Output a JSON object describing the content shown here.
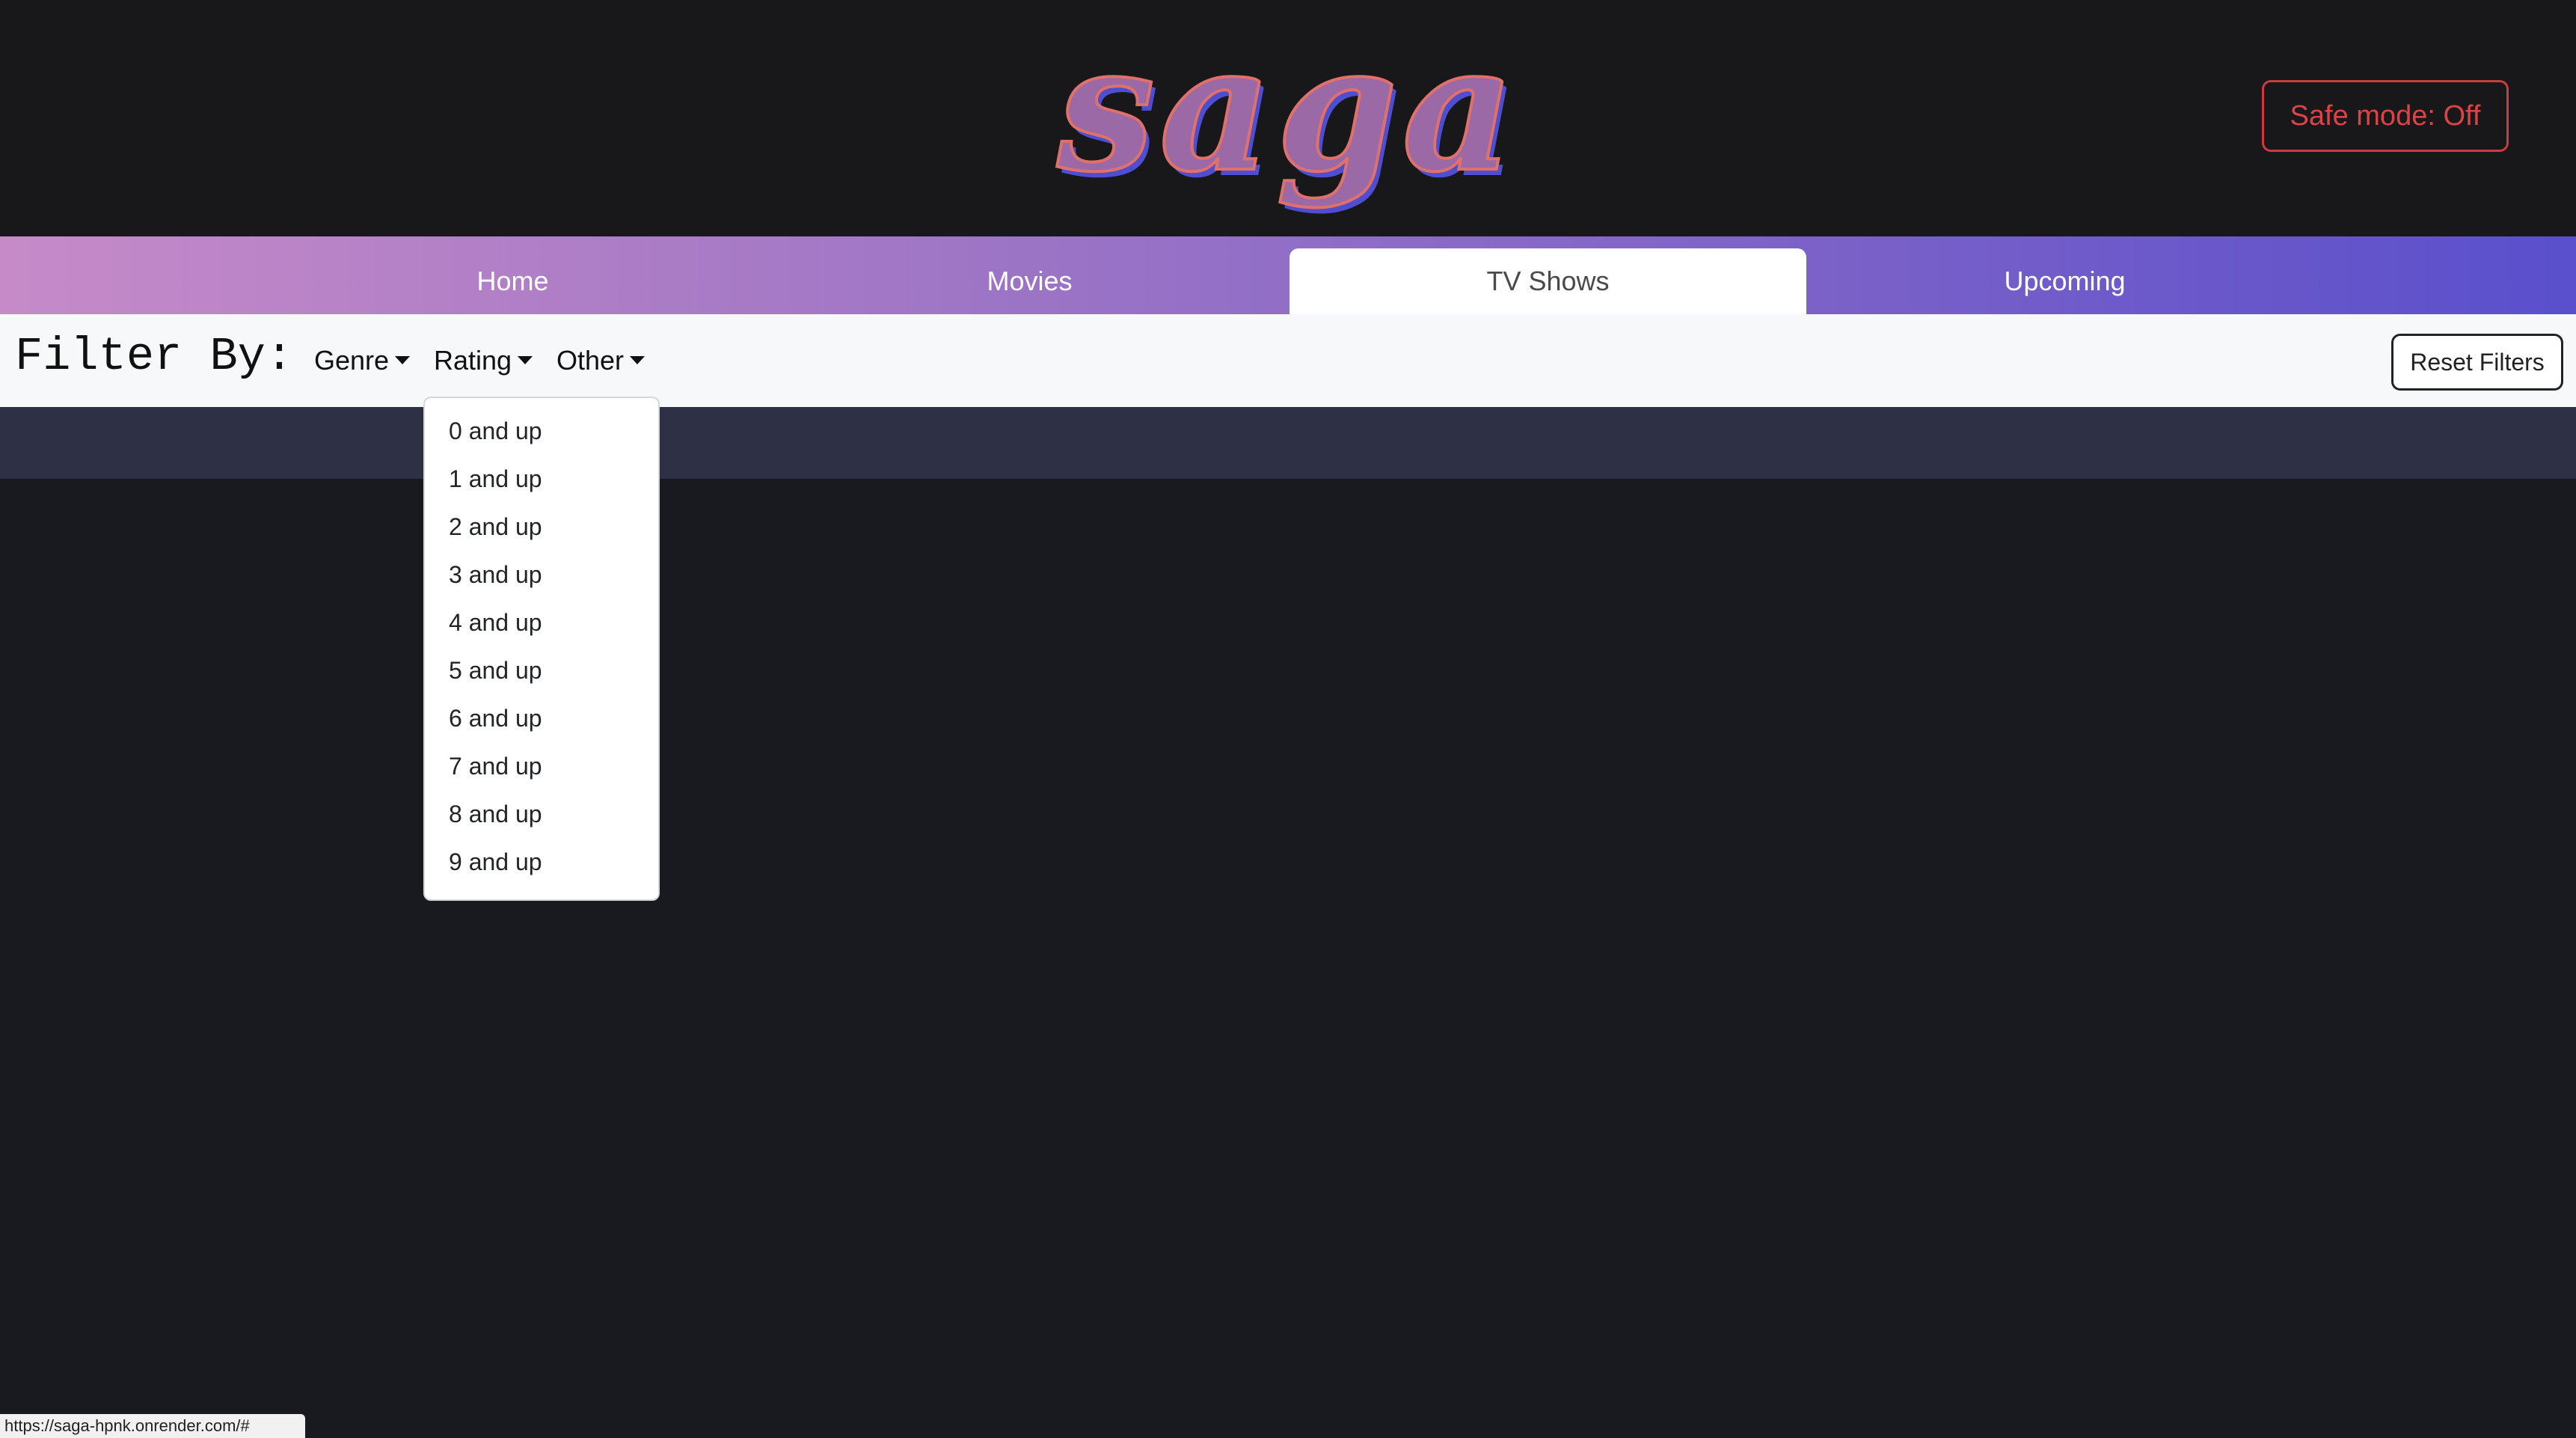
{
  "header": {
    "logo_text": "saga",
    "safe_mode_label": "Safe mode: Off"
  },
  "nav": {
    "tabs": [
      {
        "label": "Home"
      },
      {
        "label": "Movies"
      },
      {
        "label": "TV Shows",
        "active": true
      },
      {
        "label": "Upcoming"
      }
    ]
  },
  "filter": {
    "title": "Filter By:",
    "dropdowns": [
      {
        "label": "Genre"
      },
      {
        "label": "Rating",
        "open": true
      },
      {
        "label": "Other"
      }
    ],
    "reset_label": "Reset Filters"
  },
  "rating_menu": {
    "items": [
      "0 and up",
      "1 and up",
      "2 and up",
      "3 and up",
      "4 and up",
      "5 and up",
      "6 and up",
      "7 and up",
      "8 and up",
      "9 and up"
    ]
  },
  "status_bar": {
    "url": "https://saga-hpnk.onrender.com/#"
  },
  "colors": {
    "page_bg": "#191a1f",
    "header_bg": "#18181a",
    "safe_mode_red": "#db4347",
    "nav_gradient_start": "#c68ac8",
    "nav_gradient_end": "#5a4fcc",
    "filter_bar_bg": "#f7f8f9",
    "sub_band_bg": "#2e3145"
  }
}
